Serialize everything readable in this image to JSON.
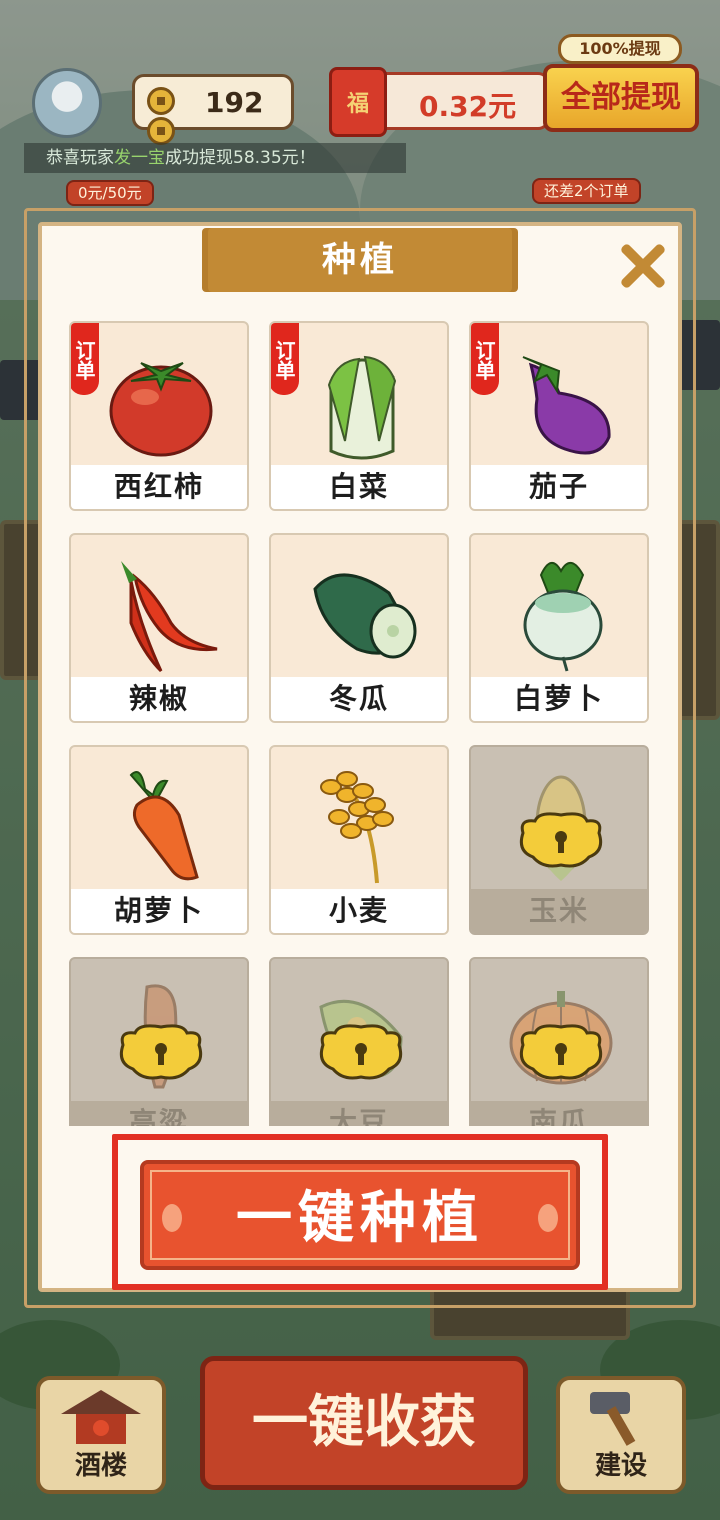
{
  "hud": {
    "coins": "192",
    "red_packet_icon": "福",
    "red_packet_amount": "0.32元",
    "withdraw_tag": "100%提现",
    "withdraw_button": "全部提现",
    "ticker_prefix": "恭喜玩家",
    "ticker_name": "发一宝",
    "ticker_suffix": "成功提现58.35元！",
    "progress_tag": "0元/50元",
    "orders_tag": "还差2个订单"
  },
  "modal": {
    "title": "种植",
    "order_badge": "订单",
    "crops": [
      {
        "name": "西红柿",
        "icon": "tomato-icon",
        "order": true,
        "locked": false
      },
      {
        "name": "白菜",
        "icon": "napa-cabbage-icon",
        "order": true,
        "locked": false
      },
      {
        "name": "茄子",
        "icon": "eggplant-icon",
        "order": true,
        "locked": false
      },
      {
        "name": "辣椒",
        "icon": "chili-pepper-icon",
        "order": false,
        "locked": false
      },
      {
        "name": "冬瓜",
        "icon": "winter-melon-icon",
        "order": false,
        "locked": false
      },
      {
        "name": "白萝卜",
        "icon": "white-radish-icon",
        "order": false,
        "locked": false
      },
      {
        "name": "胡萝卜",
        "icon": "carrot-icon",
        "order": false,
        "locked": false
      },
      {
        "name": "小麦",
        "icon": "wheat-icon",
        "order": false,
        "locked": false
      },
      {
        "name": "玉米",
        "icon": "corn-icon",
        "order": false,
        "locked": true
      },
      {
        "name": "高粱",
        "icon": "sorghum-icon",
        "order": false,
        "locked": true
      },
      {
        "name": "大豆",
        "icon": "soybean-icon",
        "order": false,
        "locked": true
      },
      {
        "name": "南瓜",
        "icon": "pumpkin-icon",
        "order": false,
        "locked": true
      }
    ],
    "plant_all_button": "一键种植"
  },
  "bottom": {
    "tavern": "酒楼",
    "harvest_all": "一键收获",
    "build": "建设"
  }
}
